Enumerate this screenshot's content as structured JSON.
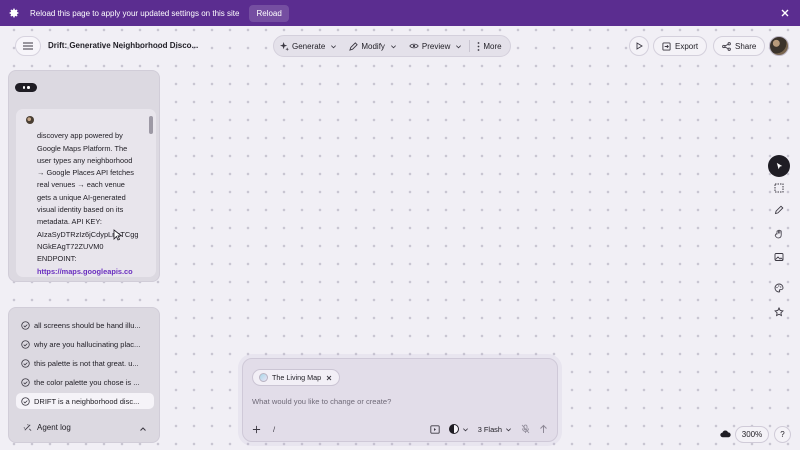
{
  "banner": {
    "message": "Reload this page to apply your updated settings on this site",
    "reload_label": "Reload"
  },
  "header": {
    "title": "Drift: Generative Neighborhood Disco...",
    "toolbar": [
      {
        "label": "Generate",
        "icon": "sparkle-icon"
      },
      {
        "label": "Modify",
        "icon": "pen-icon"
      },
      {
        "label": "Preview",
        "icon": "eye-icon"
      },
      {
        "label": "More",
        "icon": "vertical-dots-icon"
      }
    ],
    "export_label": "Export",
    "share_label": "Share"
  },
  "prompt": {
    "text": "discovery app powered by\nGoogle Maps Platform. The\nuser types any neighborhood\n→ Google Places API fetches\nreal venues → each venue\ngets a unique AI-generated\nvisual identity based on its\nmetadata. API KEY:\nAIzaSyDTRzIz6jCdypLnnTCgg\nNGkEAgT72ZUVM0\nENDPOINT:",
    "url": "https://maps.googleapis.co\nm/maps/api/place/textsearc"
  },
  "history": {
    "items": [
      "all screens should be hand illu...",
      "why are you hallucinating plac...",
      "this palette is not that great. u...",
      "the color palette you chose is ...",
      "DRIFT is a neighborhood disc..."
    ],
    "active_index": 4,
    "agent_log_label": "Agent log"
  },
  "composer": {
    "chip_label": "The Living Map",
    "placeholder": "What would you like to change or create?",
    "slash": "/",
    "model_label": "3 Flash"
  },
  "footer": {
    "zoom": "300%",
    "help": "?"
  },
  "colors": {
    "banner": "#5b2d90",
    "link": "#6a2fbf",
    "canvas": "#f1eff5"
  }
}
